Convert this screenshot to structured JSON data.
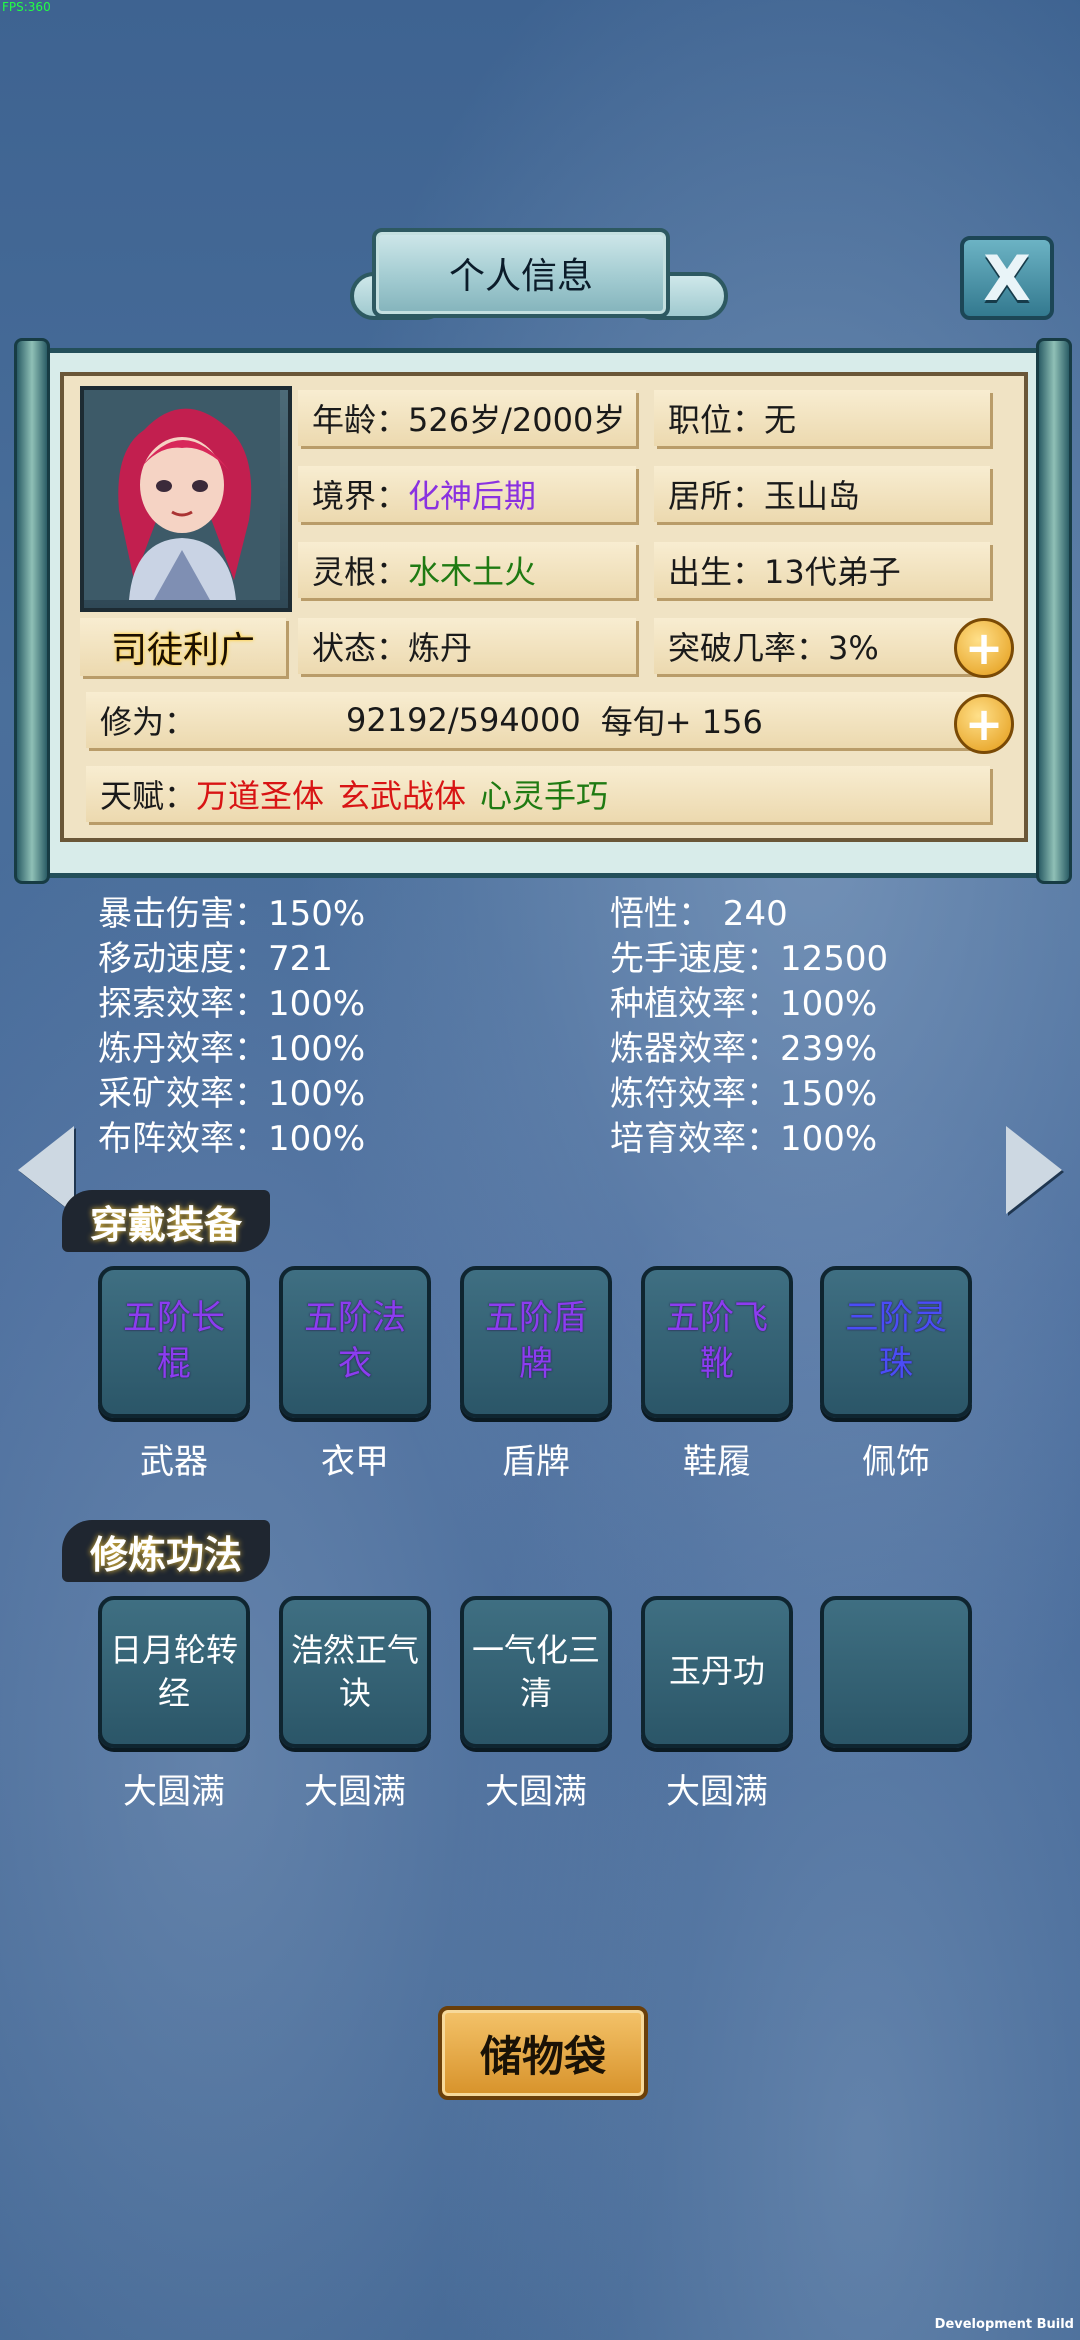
{
  "debug": {
    "fps": "FPS:360",
    "build": "Development Build"
  },
  "title": "个人信息",
  "close": "X",
  "profile": {
    "name": "司徒利广",
    "age": "年龄：526岁/2000岁",
    "position": "职位：无",
    "realm_label": "境界：",
    "realm_value": "化神后期",
    "residence": "居所：玉山岛",
    "root_label": "灵根：",
    "root_value": "水木土火",
    "origin": "出生：13代弟子",
    "status": "状态：炼丹",
    "breakthrough": "突破几率：3%",
    "cultivation_label": "修为：",
    "cultivation_value": "92192/594000",
    "cultivation_rate": "每旬+ 156",
    "talent_label": "天赋：",
    "talents": [
      "万道圣体",
      "玄武战体",
      "心灵手巧"
    ]
  },
  "colors": {
    "purple": "#8a32e0",
    "green": "#1f7a12",
    "red": "#d81414",
    "talent_green": "#1f7a12"
  },
  "stats_left": [
    "暴击伤害：150%",
    "移动速度：721",
    "探索效率：100%",
    "炼丹效率：100%",
    "采矿效率：100%",
    "布阵效率：100%"
  ],
  "stats_right": [
    "悟性： 240",
    "先手速度：12500",
    "种植效率：100%",
    "炼器效率：239%",
    "炼符效率：150%",
    "培育效率：100%"
  ],
  "equipment_title": "穿戴装备",
  "equipment": [
    {
      "item": "五阶长棍",
      "slot": "武器"
    },
    {
      "item": "五阶法衣",
      "slot": "衣甲"
    },
    {
      "item": "五阶盾牌",
      "slot": "盾牌"
    },
    {
      "item": "五阶飞靴",
      "slot": "鞋履"
    },
    {
      "item": "三阶灵珠",
      "slot": "佩饰"
    }
  ],
  "skills_title": "修炼功法",
  "skills": [
    {
      "name": "日月轮转经",
      "level": "大圆满"
    },
    {
      "name": "浩然正气诀",
      "level": "大圆满"
    },
    {
      "name": "一气化三清",
      "level": "大圆满"
    },
    {
      "name": "玉丹功",
      "level": "大圆满"
    },
    {
      "name": "",
      "level": ""
    }
  ],
  "storage_button": "储物袋",
  "icons": {
    "close": "close-icon",
    "plus": "plus-icon",
    "prev": "arrow-left-icon",
    "next": "arrow-right-icon"
  }
}
